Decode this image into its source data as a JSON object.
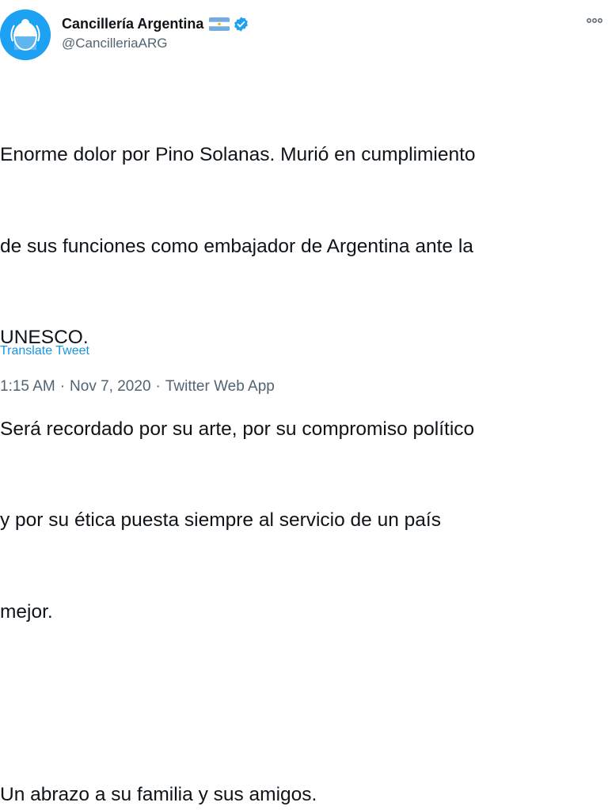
{
  "header": {
    "display_name": "Cancillería Argentina",
    "handle": "@CancilleriaARG",
    "avatar_icon": "argentina-coat-of-arms-icon",
    "flag_icon": "argentina-flag-icon",
    "verified_icon": "verified-badge-icon",
    "more_icon": "more-options-icon"
  },
  "tweet": {
    "lines": [
      "Enorme dolor por Pino Solanas. Murió en cumplimiento",
      "de sus funciones como embajador de Argentina ante la",
      "UNESCO.",
      "Será recordado por su arte, por su compromiso político",
      "y por su ética puesta siempre al servicio de un país",
      "mejor.",
      "",
      "Un abrazo a su familia y sus amigos."
    ],
    "translate_label": "Translate Tweet",
    "time": "1:15 AM",
    "date": "Nov 7, 2020",
    "source": "Twitter Web App",
    "separator": "·"
  },
  "colors": {
    "accent": "#1da1f2",
    "link": "#1b95e0",
    "text": "#0f1419",
    "secondary": "#536471"
  }
}
